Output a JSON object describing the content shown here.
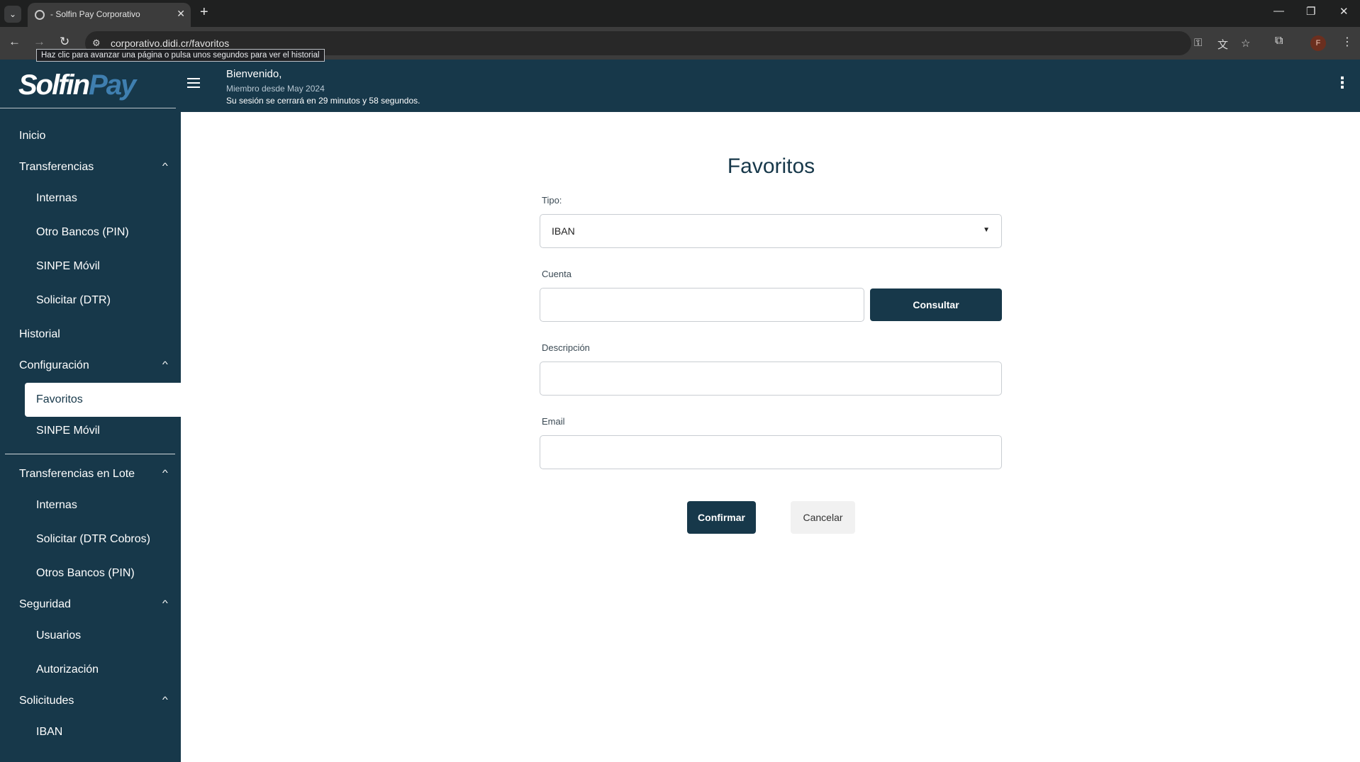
{
  "browser": {
    "tab_title": "- Solfin Pay Corporativo",
    "url": "corporativo.didi.cr/favoritos",
    "tooltip": "Haz clic para avanzar una página o pulsa unos segundos para ver el historial",
    "profile_initial": "F"
  },
  "header": {
    "logo_part1": "Solfin",
    "logo_part2": "Pay",
    "welcome": "Bienvenido,",
    "member_since": "Miembro desde May 2024",
    "session_notice": "Su sesión se cerrará en 29 minutos y 58 segundos."
  },
  "sidebar": {
    "items": [
      {
        "label": "Inicio"
      },
      {
        "label": "Transferencias"
      },
      {
        "label": "Internas"
      },
      {
        "label": "Otro Bancos (PIN)"
      },
      {
        "label": "SINPE Móvil"
      },
      {
        "label": "Solicitar (DTR)"
      },
      {
        "label": "Historial"
      },
      {
        "label": "Configuración"
      },
      {
        "label": "Favoritos"
      },
      {
        "label": "SINPE Móvil"
      },
      {
        "label": "Transferencias en Lote"
      },
      {
        "label": "Internas"
      },
      {
        "label": "Solicitar (DTR Cobros)"
      },
      {
        "label": "Otros Bancos (PIN)"
      },
      {
        "label": "Seguridad"
      },
      {
        "label": "Usuarios"
      },
      {
        "label": "Autorización"
      },
      {
        "label": "Solicitudes"
      },
      {
        "label": "IBAN"
      }
    ]
  },
  "form": {
    "title": "Favoritos",
    "tipo_label": "Tipo:",
    "tipo_value": "IBAN",
    "cuenta_label": "Cuenta",
    "cuenta_value": "",
    "consultar_label": "Consultar",
    "descripcion_label": "Descripción",
    "descripcion_value": "",
    "email_label": "Email",
    "email_value": "",
    "confirmar_label": "Confirmar",
    "cancelar_label": "Cancelar"
  }
}
